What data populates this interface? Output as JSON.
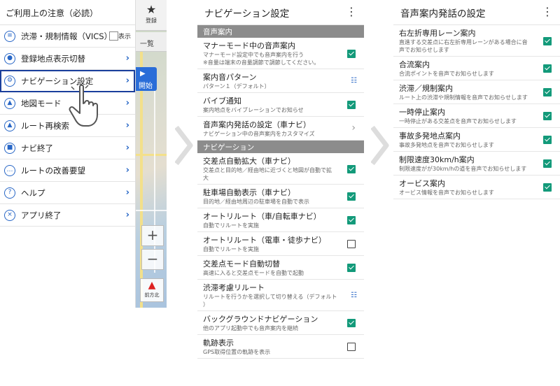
{
  "panel1": {
    "title": "ご利用上の注意（必読）",
    "vics_label": "表示",
    "map_star_label": "登録",
    "map_tab_label": "一覧",
    "map_start_label": "開始",
    "compass_label": "前方北",
    "menu": [
      {
        "label": "渋滞・規制情報（VICS）",
        "icon": "road-icon",
        "glyph": "≡"
      },
      {
        "label": "登録地点表示切替",
        "icon": "pin-icon",
        "glyph": "●"
      },
      {
        "label": "ナビゲーション設定",
        "icon": "gear-icon",
        "glyph": "⚙"
      },
      {
        "label": "地図モード",
        "icon": "person-icon",
        "glyph": "▲"
      },
      {
        "label": "ルート再検索",
        "icon": "navigation-icon",
        "glyph": "▲"
      },
      {
        "label": "ナビ終了",
        "icon": "stop-icon",
        "glyph": "■"
      },
      {
        "label": "ルートの改善要望",
        "icon": "chat-icon",
        "glyph": "…"
      },
      {
        "label": "ヘルプ",
        "icon": "help-icon",
        "glyph": "?"
      },
      {
        "label": "アプリ終了",
        "icon": "close-icon",
        "glyph": "×"
      }
    ]
  },
  "panel2": {
    "title": "ナビゲーション設定",
    "section_voice": "音声案内",
    "section_nav": "ナビゲーション",
    "voice_items": [
      {
        "title": "マナーモード中の音声案内",
        "sub": "マナーモード設定中でも音声案内を行う",
        "sub2": "※音量は端末の音量調節で調節してください。",
        "control": "check-on"
      },
      {
        "title": "案内音パターン",
        "sub": "パターン１（デフォルト）",
        "control": "select"
      },
      {
        "title": "バイブ通知",
        "sub": "案内地点をバイブレーションでお知らせ",
        "control": "check-on"
      },
      {
        "title": "音声案内発話の設定（車ナビ）",
        "sub": "ナビゲーション中の音声案内をカスタマイズ",
        "control": "chevron"
      }
    ],
    "nav_items": [
      {
        "title": "交差点自動拡大（車ナビ）",
        "sub": "交差点と目的地／経由地に近づくと地図が自動で拡",
        "sub2": "大",
        "control": "check-on"
      },
      {
        "title": "駐車場自動表示（車ナビ）",
        "sub": "目的地／経由地周辺の駐車場を自動で表示",
        "control": "check-on"
      },
      {
        "title": "オートリルート（車/自転車ナビ）",
        "sub": "自動でリルートを実施",
        "control": "check-on"
      },
      {
        "title": "オートリルート（電車・徒歩ナビ）",
        "sub": "自動でリルートを実施",
        "control": "check-off"
      },
      {
        "title": "交差点モード自動切替",
        "sub": "高速に入ると交差点モードを自動で起動",
        "control": "check-on"
      },
      {
        "title": "渋滞考慮リルート",
        "sub": "リルートを行うかを選択して切り替える（デフォルト",
        "sub2": "）",
        "control": "select"
      },
      {
        "title": "バックグラウンドナビゲーション",
        "sub": "他のアプリ起動中でも音声案内を継続",
        "control": "check-on"
      },
      {
        "title": "軌跡表示",
        "sub": "GPS取得位置の軌跡を表示",
        "control": "check-off"
      }
    ]
  },
  "panel3": {
    "title": "音声案内発話の設定",
    "items": [
      {
        "title": "右左折専用レーン案内",
        "sub": "直進する交差点に右左折専用レーンがある場合に音",
        "sub2": "声でお知らせします",
        "control": "check-on"
      },
      {
        "title": "合流案内",
        "sub": "合流ポイントを音声でお知らせします",
        "control": "check-on"
      },
      {
        "title": "渋滞／規制案内",
        "sub": "ルート上の渋滞や規制情報を音声でお知らせします",
        "control": "check-on"
      },
      {
        "title": "一時停止案内",
        "sub": "一時停止がある交差点を音声でお知らせします",
        "control": "check-on"
      },
      {
        "title": "事故多発地点案内",
        "sub": "事故多発地点を音声でお知らせします",
        "control": "check-on"
      },
      {
        "title": "制限速度30km/h案内",
        "sub": "制限速度がが30km/hの道を音声でお知らせします",
        "control": "check-on"
      },
      {
        "title": "オービス案内",
        "sub": "オービス情報を音声でお知らせします",
        "control": "check-on"
      }
    ]
  },
  "colors": {
    "accent": "#2766c6",
    "check": "#139a7a",
    "section": "#8c8c8c",
    "highlight": "#1a3f9c"
  }
}
